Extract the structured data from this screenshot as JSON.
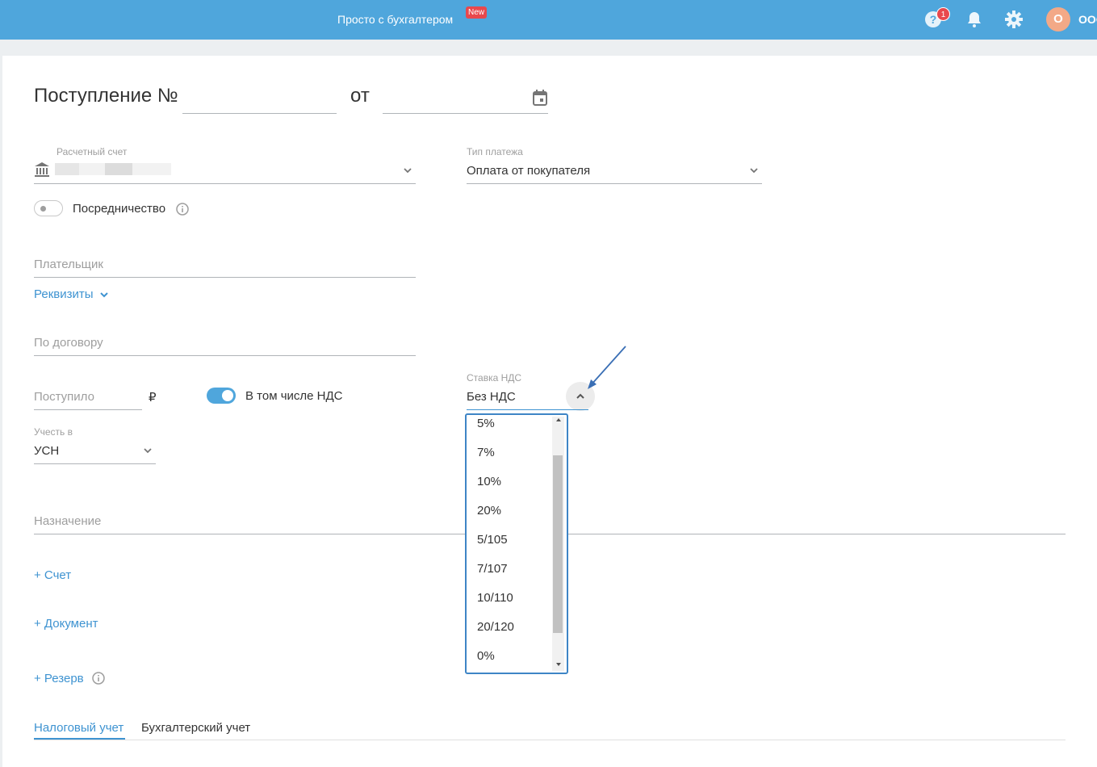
{
  "topbar": {
    "promo": "Просто с бухгалтером",
    "new_badge": "New",
    "help_badge_count": "1",
    "avatar_letter": "О",
    "org_name": "ООО"
  },
  "form": {
    "title": "Поступление №",
    "date_sep": "от",
    "account": {
      "label": "Расчетный счет"
    },
    "payment_type": {
      "label": "Тип платежа",
      "value": "Оплата от покупателя"
    },
    "mediation": {
      "label": "Посредничество",
      "enabled": false
    },
    "payer": {
      "placeholder": "Плательщик"
    },
    "requisites_link": "Реквизиты",
    "contract": {
      "placeholder": "По договору"
    },
    "received": {
      "placeholder": "Поступило",
      "currency": "₽"
    },
    "vat_included": {
      "label": "В том числе НДС",
      "enabled": true
    },
    "vat_rate": {
      "label": "Ставка НДС",
      "value": "Без НДС",
      "options": [
        "5%",
        "7%",
        "10%",
        "20%",
        "5/105",
        "7/107",
        "10/110",
        "20/120",
        "0%"
      ]
    },
    "account_in": {
      "label": "Учесть в",
      "value": "УСН"
    },
    "purpose": {
      "placeholder": "Назначение"
    },
    "add_invoice": "+ Счет",
    "add_document": "+ Документ",
    "add_reserve": "+ Резерв",
    "tabs": [
      {
        "label": "Налоговый учет",
        "active": true
      },
      {
        "label": "Бухгалтерский учет",
        "active": false
      }
    ]
  },
  "colors": {
    "topbar": "#4fa6dc",
    "accent": "#3e93d1",
    "badge": "#e8484d"
  }
}
